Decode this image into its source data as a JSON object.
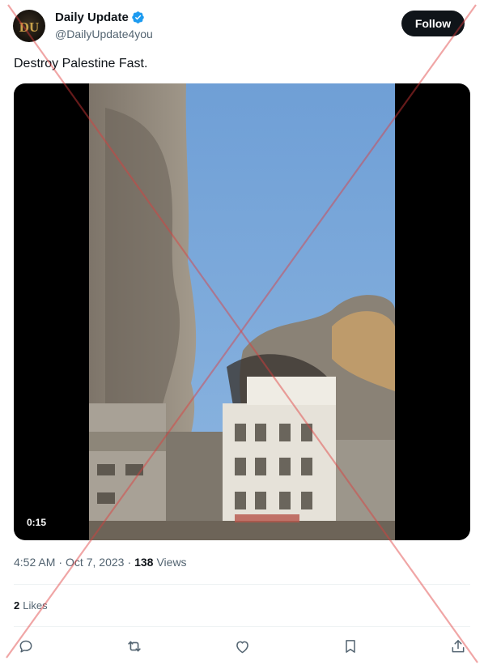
{
  "author": {
    "avatar_text": "DU",
    "display_name": "Daily Update",
    "handle": "@DailyUpdate4you",
    "verified_icon": "verified-badge-icon"
  },
  "follow_button": {
    "label": "Follow"
  },
  "tweet": {
    "text": "Destroy Palestine Fast."
  },
  "media": {
    "type": "video",
    "timecode": "0:15"
  },
  "meta": {
    "time": "4:52 AM",
    "separator": "·",
    "date": "Oct 7, 2023",
    "views_count": "138",
    "views_label": "Views"
  },
  "engagement": {
    "likes_count": "2",
    "likes_label": "Likes"
  },
  "actions": [
    "reply-icon",
    "retweet-icon",
    "like-icon",
    "bookmark-icon",
    "share-icon"
  ],
  "colors": {
    "text_primary": "#0f1419",
    "text_secondary": "#536471",
    "verified_blue": "#1d9bf0",
    "follow_bg": "#0f1419",
    "overlay_x": "#e03b3b",
    "divider": "#eff3f4"
  }
}
